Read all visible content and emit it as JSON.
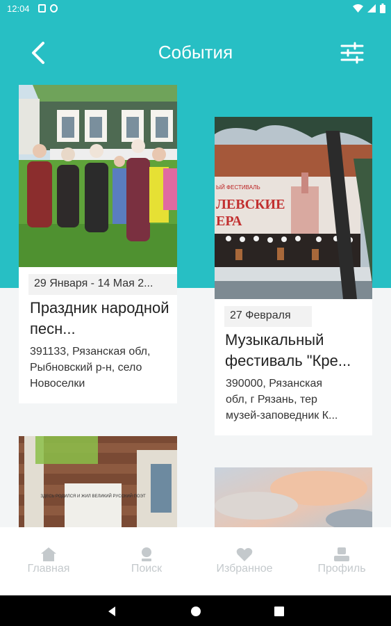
{
  "status_bar": {
    "time": "12:04"
  },
  "app_bar": {
    "title": "События"
  },
  "events": [
    {
      "date": "29 Января - 14 Мая 2...",
      "title": "Праздник народной песн...",
      "address": "391133, Рязанская обл, Рыбновский р-н, село Новоселки"
    },
    {
      "date": "27 Февраля",
      "title": "Музыкальный фестиваль \"Кре...",
      "address_line1": "390000, Рязанская",
      "address_line2": "обл, г Рязань, тер",
      "address_line3": "музей-заповедник К..."
    },
    {
      "image_text": "ЗДЕСЬ РОДИЛСЯ И ЖИЛ ВЕЛИКИЙ РУССКИЙ ПОЭТ"
    },
    {}
  ],
  "poster": {
    "festival": "ЫЙ ФЕСТИВАЛЬ",
    "title1": "ЛЕВСКИЕ",
    "title2": "ЕРА"
  },
  "bottom_nav": [
    {
      "label": "Главная",
      "icon": "home-icon"
    },
    {
      "label": "Поиск",
      "icon": "location-pin-icon"
    },
    {
      "label": "Избранное",
      "icon": "heart-icon"
    },
    {
      "label": "Профиль",
      "icon": "person-icon"
    }
  ],
  "colors": {
    "accent": "#27bfc4",
    "background": "#f3f5f6",
    "nav_inactive": "#c4c9cc"
  }
}
